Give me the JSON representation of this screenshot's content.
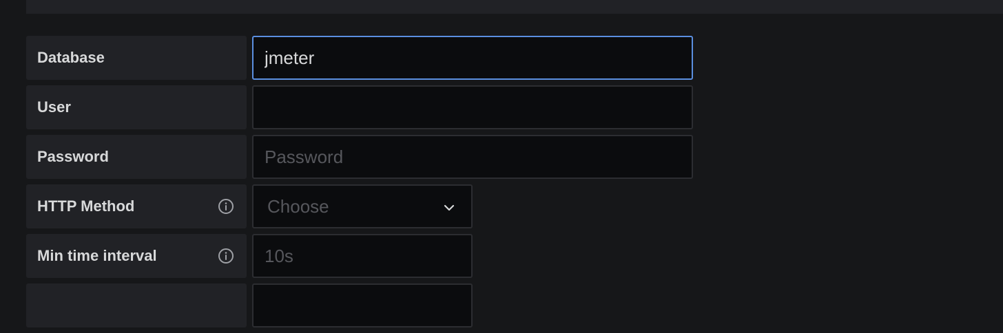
{
  "form": {
    "database": {
      "label": "Database",
      "value": "jmeter"
    },
    "user": {
      "label": "User",
      "value": ""
    },
    "password": {
      "label": "Password",
      "placeholder": "Password"
    },
    "http_method": {
      "label": "HTTP Method",
      "selected": "Choose"
    },
    "min_time_interval": {
      "label": "Min time interval",
      "placeholder": "10s"
    }
  },
  "icons": {
    "info": "info-icon",
    "dropdown": "chevron-down-icon"
  },
  "colors": {
    "background": "#161719",
    "label_bg": "#212226",
    "input_bg": "#0b0c0e",
    "focus_border": "#5b8fe0",
    "text": "#d8d9da",
    "placeholder": "#56575c"
  }
}
